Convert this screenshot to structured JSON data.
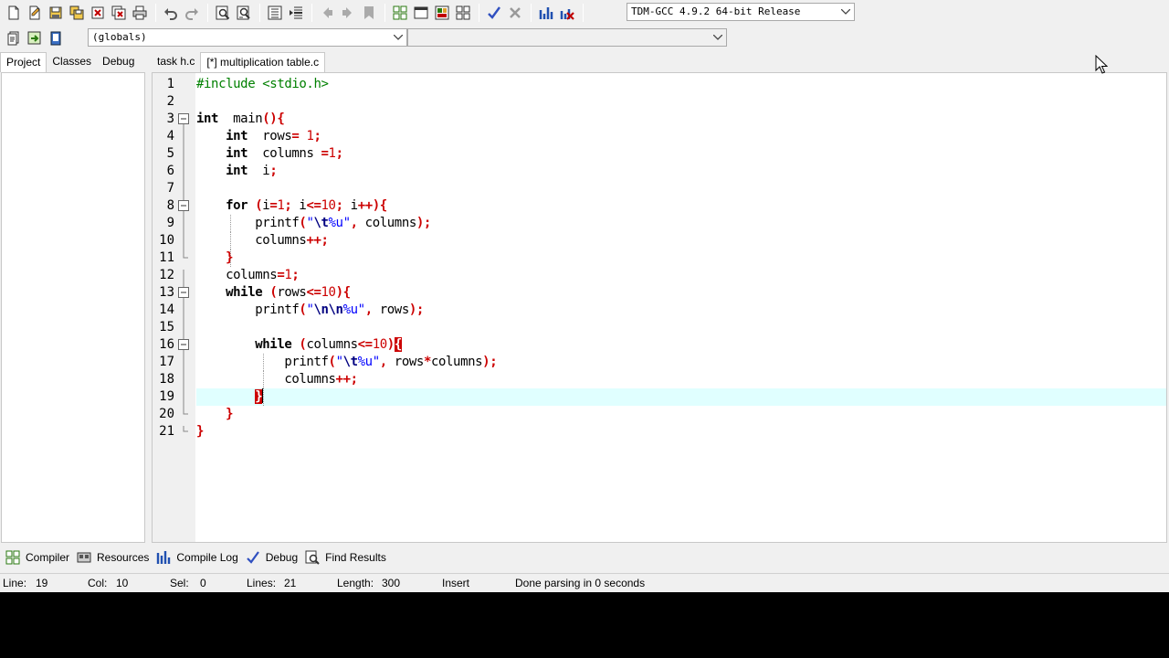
{
  "toolbar": {
    "buttons": [
      "new-file-icon",
      "open-file-icon",
      "save-icon",
      "save-all-icon",
      "close-icon",
      "close-all-icon",
      "print-icon",
      "undo-icon",
      "redo-icon",
      "find-icon",
      "replace-icon",
      "indent-icon",
      "unindent-icon",
      "back-icon",
      "forward-icon",
      "bookmark-icon",
      "new-project-icon",
      "view-icon",
      "window-icon",
      "grid-icon",
      "check-syntax-icon",
      "stop-icon",
      "chart-icon",
      "profile-icon"
    ],
    "compiler": "TDM-GCC 4.9.2 64-bit Release",
    "globals": "(globals)",
    "members": ""
  },
  "left_tabs": [
    "Project",
    "Classes",
    "Debug"
  ],
  "editor_tabs": [
    "task h.c",
    "[*] multiplication table.c"
  ],
  "code": [
    [
      [
        "pp",
        "#include <stdio.h>"
      ]
    ],
    [],
    [
      [
        "kw",
        "int"
      ],
      [
        "",
        "  main"
      ],
      [
        "sy",
        "(){"
      ]
    ],
    [
      [
        "",
        "    "
      ],
      [
        "kw",
        "int"
      ],
      [
        "",
        "  rows"
      ],
      [
        "sy",
        "="
      ],
      [
        "",
        " "
      ],
      [
        "num",
        "1"
      ],
      [
        "sy",
        ";"
      ]
    ],
    [
      [
        "",
        "    "
      ],
      [
        "kw",
        "int"
      ],
      [
        "",
        "  columns "
      ],
      [
        "sy",
        "="
      ],
      [
        "num",
        "1"
      ],
      [
        "sy",
        ";"
      ]
    ],
    [
      [
        "",
        "    "
      ],
      [
        "kw",
        "int"
      ],
      [
        "",
        "  i"
      ],
      [
        "sy",
        ";"
      ]
    ],
    [],
    [
      [
        "",
        "    "
      ],
      [
        "kw",
        "for"
      ],
      [
        "",
        " "
      ],
      [
        "sy",
        "("
      ],
      [
        "",
        "i"
      ],
      [
        "sy",
        "="
      ],
      [
        "num",
        "1"
      ],
      [
        "sy",
        ";"
      ],
      [
        "",
        " i"
      ],
      [
        "sy",
        "<="
      ],
      [
        "num",
        "10"
      ],
      [
        "sy",
        ";"
      ],
      [
        "",
        " i"
      ],
      [
        "sy",
        "++){"
      ]
    ],
    [
      [
        "",
        "        printf"
      ],
      [
        "sy",
        "("
      ],
      [
        "str",
        "\""
      ],
      [
        "esc",
        "\\t"
      ],
      [
        "str",
        "%u\""
      ],
      [
        "sy",
        ","
      ],
      [
        "",
        " columns"
      ],
      [
        "sy",
        ");"
      ]
    ],
    [
      [
        "",
        "        columns"
      ],
      [
        "sy",
        "++;"
      ]
    ],
    [
      [
        "",
        "    "
      ],
      [
        "sy",
        "}"
      ]
    ],
    [
      [
        "",
        "    columns"
      ],
      [
        "sy",
        "="
      ],
      [
        "num",
        "1"
      ],
      [
        "sy",
        ";"
      ]
    ],
    [
      [
        "",
        "    "
      ],
      [
        "kw",
        "while"
      ],
      [
        "",
        " "
      ],
      [
        "sy",
        "("
      ],
      [
        "",
        "rows"
      ],
      [
        "sy",
        "<="
      ],
      [
        "num",
        "10"
      ],
      [
        "sy",
        "){"
      ]
    ],
    [
      [
        "",
        "        printf"
      ],
      [
        "sy",
        "("
      ],
      [
        "str",
        "\""
      ],
      [
        "esc",
        "\\n\\n"
      ],
      [
        "str",
        "%u\""
      ],
      [
        "sy",
        ","
      ],
      [
        "",
        " rows"
      ],
      [
        "sy",
        ");"
      ]
    ],
    [],
    [
      [
        "",
        "        "
      ],
      [
        "kw",
        "while"
      ],
      [
        "",
        " "
      ],
      [
        "sy",
        "("
      ],
      [
        "",
        "columns"
      ],
      [
        "sy",
        "<="
      ],
      [
        "num",
        "10"
      ],
      [
        "sy",
        ")"
      ],
      [
        "match",
        "{"
      ]
    ],
    [
      [
        "",
        "            printf"
      ],
      [
        "sy",
        "("
      ],
      [
        "str",
        "\""
      ],
      [
        "esc",
        "\\t"
      ],
      [
        "str",
        "%u\""
      ],
      [
        "sy",
        ","
      ],
      [
        "",
        " rows"
      ],
      [
        "sy",
        "*"
      ],
      [
        "",
        "columns"
      ],
      [
        "sy",
        ");"
      ]
    ],
    [
      [
        "",
        "            columns"
      ],
      [
        "sy",
        "++;"
      ]
    ],
    [
      [
        "",
        "        "
      ],
      [
        "match",
        "}"
      ],
      [
        "caret",
        ""
      ]
    ],
    [
      [
        "",
        "    "
      ],
      [
        "sy",
        "}"
      ]
    ],
    [
      [
        "sy",
        "}"
      ]
    ]
  ],
  "folds": {
    "3": "open",
    "8": "open",
    "13": "open",
    "16": "open",
    "11": "end",
    "20": "end",
    "21": "end"
  },
  "current_line": 19,
  "bottom_tabs": [
    {
      "label": "Compiler",
      "icon": "compiler-grid-icon"
    },
    {
      "label": "Resources",
      "icon": "resources-icon"
    },
    {
      "label": "Compile Log",
      "icon": "compile-log-icon"
    },
    {
      "label": "Debug",
      "icon": "debug-check-icon"
    },
    {
      "label": "Find Results",
      "icon": "find-results-icon"
    }
  ],
  "status": {
    "line_label": "Line:",
    "line": "19",
    "col_label": "Col:",
    "col": "10",
    "sel_label": "Sel:",
    "sel": "0",
    "lines_label": "Lines:",
    "lines": "21",
    "length_label": "Length:",
    "length": "300",
    "mode": "Insert",
    "message": "Done parsing in 0 seconds"
  },
  "colors": {
    "current_line": "#e0ffff",
    "keyword": "#000000",
    "preprocessor": "#008000",
    "symbol": "#cc0000",
    "string": "#0000ff"
  }
}
